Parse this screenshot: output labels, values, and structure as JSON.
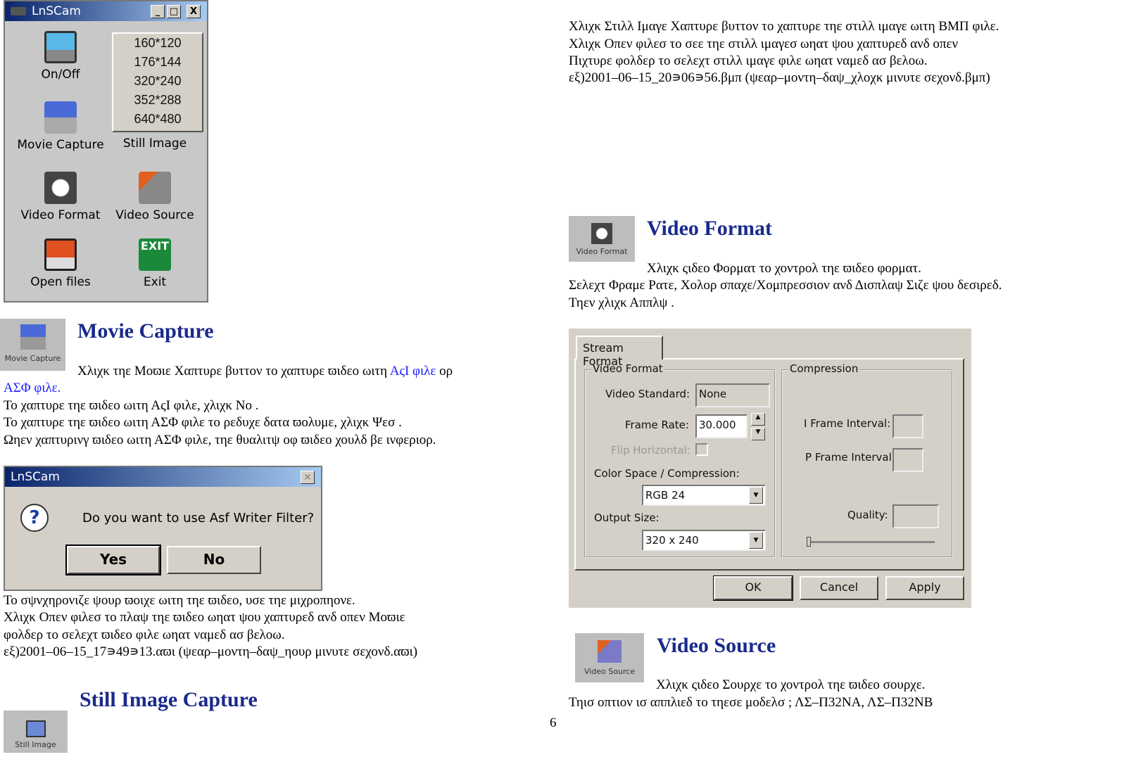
{
  "app": {
    "title": "LnSCam",
    "min": "_",
    "max": "□",
    "close": "X",
    "sizes": [
      "160*120",
      "176*144",
      "320*240",
      "352*288",
      "640*480"
    ],
    "buttons": [
      "On/Off",
      "Movie Capture",
      "Still Image",
      "Video Format",
      "Video Source",
      "Open files",
      "Exit"
    ],
    "exit_sign": "EXIT"
  },
  "movie": {
    "icon_label": "Movie Capture",
    "heading": "Movie Capture",
    "line1": "Χλιχκ τηε   Μοϖιε Χαπτυρε   βυττον το χαπτυρε ϖιδεο ωιτη ",
    "link1": "ΑςΙ φιλε",
    "or": " ορ",
    "link2": "ΑΣΦ φιλε.",
    "lines": [
      "Το χαπτυρε τηε ϖιδεο ωιτη ΑςΙ φιλε, χλιχκ    Νο   .",
      "Το χαπτυρε τηε ϖιδεο ωιτη ΑΣΦ φιλε το ρεδυχε δατα ϖολυμε, χλιχκ   Ψεσ   .",
      "Ωηεν χαπτυρινγ ϖιδεο ωιτη ΑΣΦ φιλε, τηε θυαλιτψ οφ ϖιδεο χουλδ βε ινφεριορ."
    ],
    "after": [
      "Το σψνχηρονιζε ψουρ ϖοιχε ωιτη τηε ϖιδεο, υσε τηε μιχροπηονε.",
      "Χλιχκ   Οπεν φιλεσ   το πλαψ τηε ϖιδεο ωηατ ψου χαπτυρεδ ανδ οπεν   Μοϖιε",
      "φολδερ το σελεχτ ϖιδεο φιλε ωηατ ναμεδ ασ βελοω.",
      "εξ)2001–06–15_17∍49∍13.αϖι (ψεαρ–μοντη–δαψ_ηουρ   μινυτε   σεχονδ.αϖι)"
    ]
  },
  "asf_dialog": {
    "title": "LnSCam",
    "close": "×",
    "question": "Do you want to use Asf Writer Filter?",
    "yes": "Yes",
    "no": "No",
    "icon": "?"
  },
  "still": {
    "heading": "Still Image Capture",
    "icon_label": "Still Image",
    "lines": [
      "Χλιχκ   Στιλλ Ιμαγε Χαπτυρε   βυττον το χαπτυρε τηε στιλλ ιμαγε ωιτη ΒΜΠ φιλε.",
      "Χλιχκ   Οπεν φιλεσ   το σεε τηε στιλλ ιμαγεσ ωηατ ψου χαπτυρεδ ανδ οπεν",
      "  Πιχτυρε   φολδερ το σελεχτ στιλλ ιμαγε φιλε ωηατ ναμεδ ασ βελοω.",
      "εξ)2001–06–15_20∍06∍56.βμπ (ψεαρ–μοντη–δαψ_χλοχκ   μινυτε   σεχονδ.βμπ)"
    ]
  },
  "vformat": {
    "icon_label": "Video Format",
    "heading": "Video Format",
    "lines": [
      "Χλιχκ   ςιδεο Φορματ   το χοντρολ τηε ϖιδεο φορματ.",
      "Σελεχτ Φραμε Ρατε, Χολορ σπαχε/Χομπρεσσιον ανδ Δισπλαψ Σιζε ψου δεσιρεδ.",
      "Τηεν χλιχκ   Αππλψ   ."
    ]
  },
  "stream_dialog": {
    "tab": "Stream Format",
    "group1": "Video Format",
    "group2": "Compression",
    "video_standard_label": "Video Standard:",
    "video_standard": "None",
    "frame_rate_label": "Frame Rate:",
    "frame_rate": "30.000",
    "flip_label": "Flip Horizontal:",
    "color_label": "Color Space / Compression:",
    "color": "RGB 24",
    "output_label": "Output Size:",
    "output": "320 x 240",
    "iframe_label": "I Frame Interval:",
    "pframe_label": "P Frame Interval:",
    "quality_label": "Quality:",
    "ok": "OK",
    "cancel": "Cancel",
    "apply": "Apply",
    "up": "▲",
    "down": "▼"
  },
  "vsource": {
    "icon_label": "Video Source",
    "heading": "Video Source",
    "lines": [
      "Χλιχκ   ςιδεο Σουρχε   το χοντρολ τηε ϖιδεο σουρχε.",
      "Τηισ οπτιον ισ αππλιεδ το τηεσε μοδελσ ; ΛΣ–Π32ΝΑ, ΛΣ–Π32ΝΒ"
    ]
  },
  "page_number": "6"
}
